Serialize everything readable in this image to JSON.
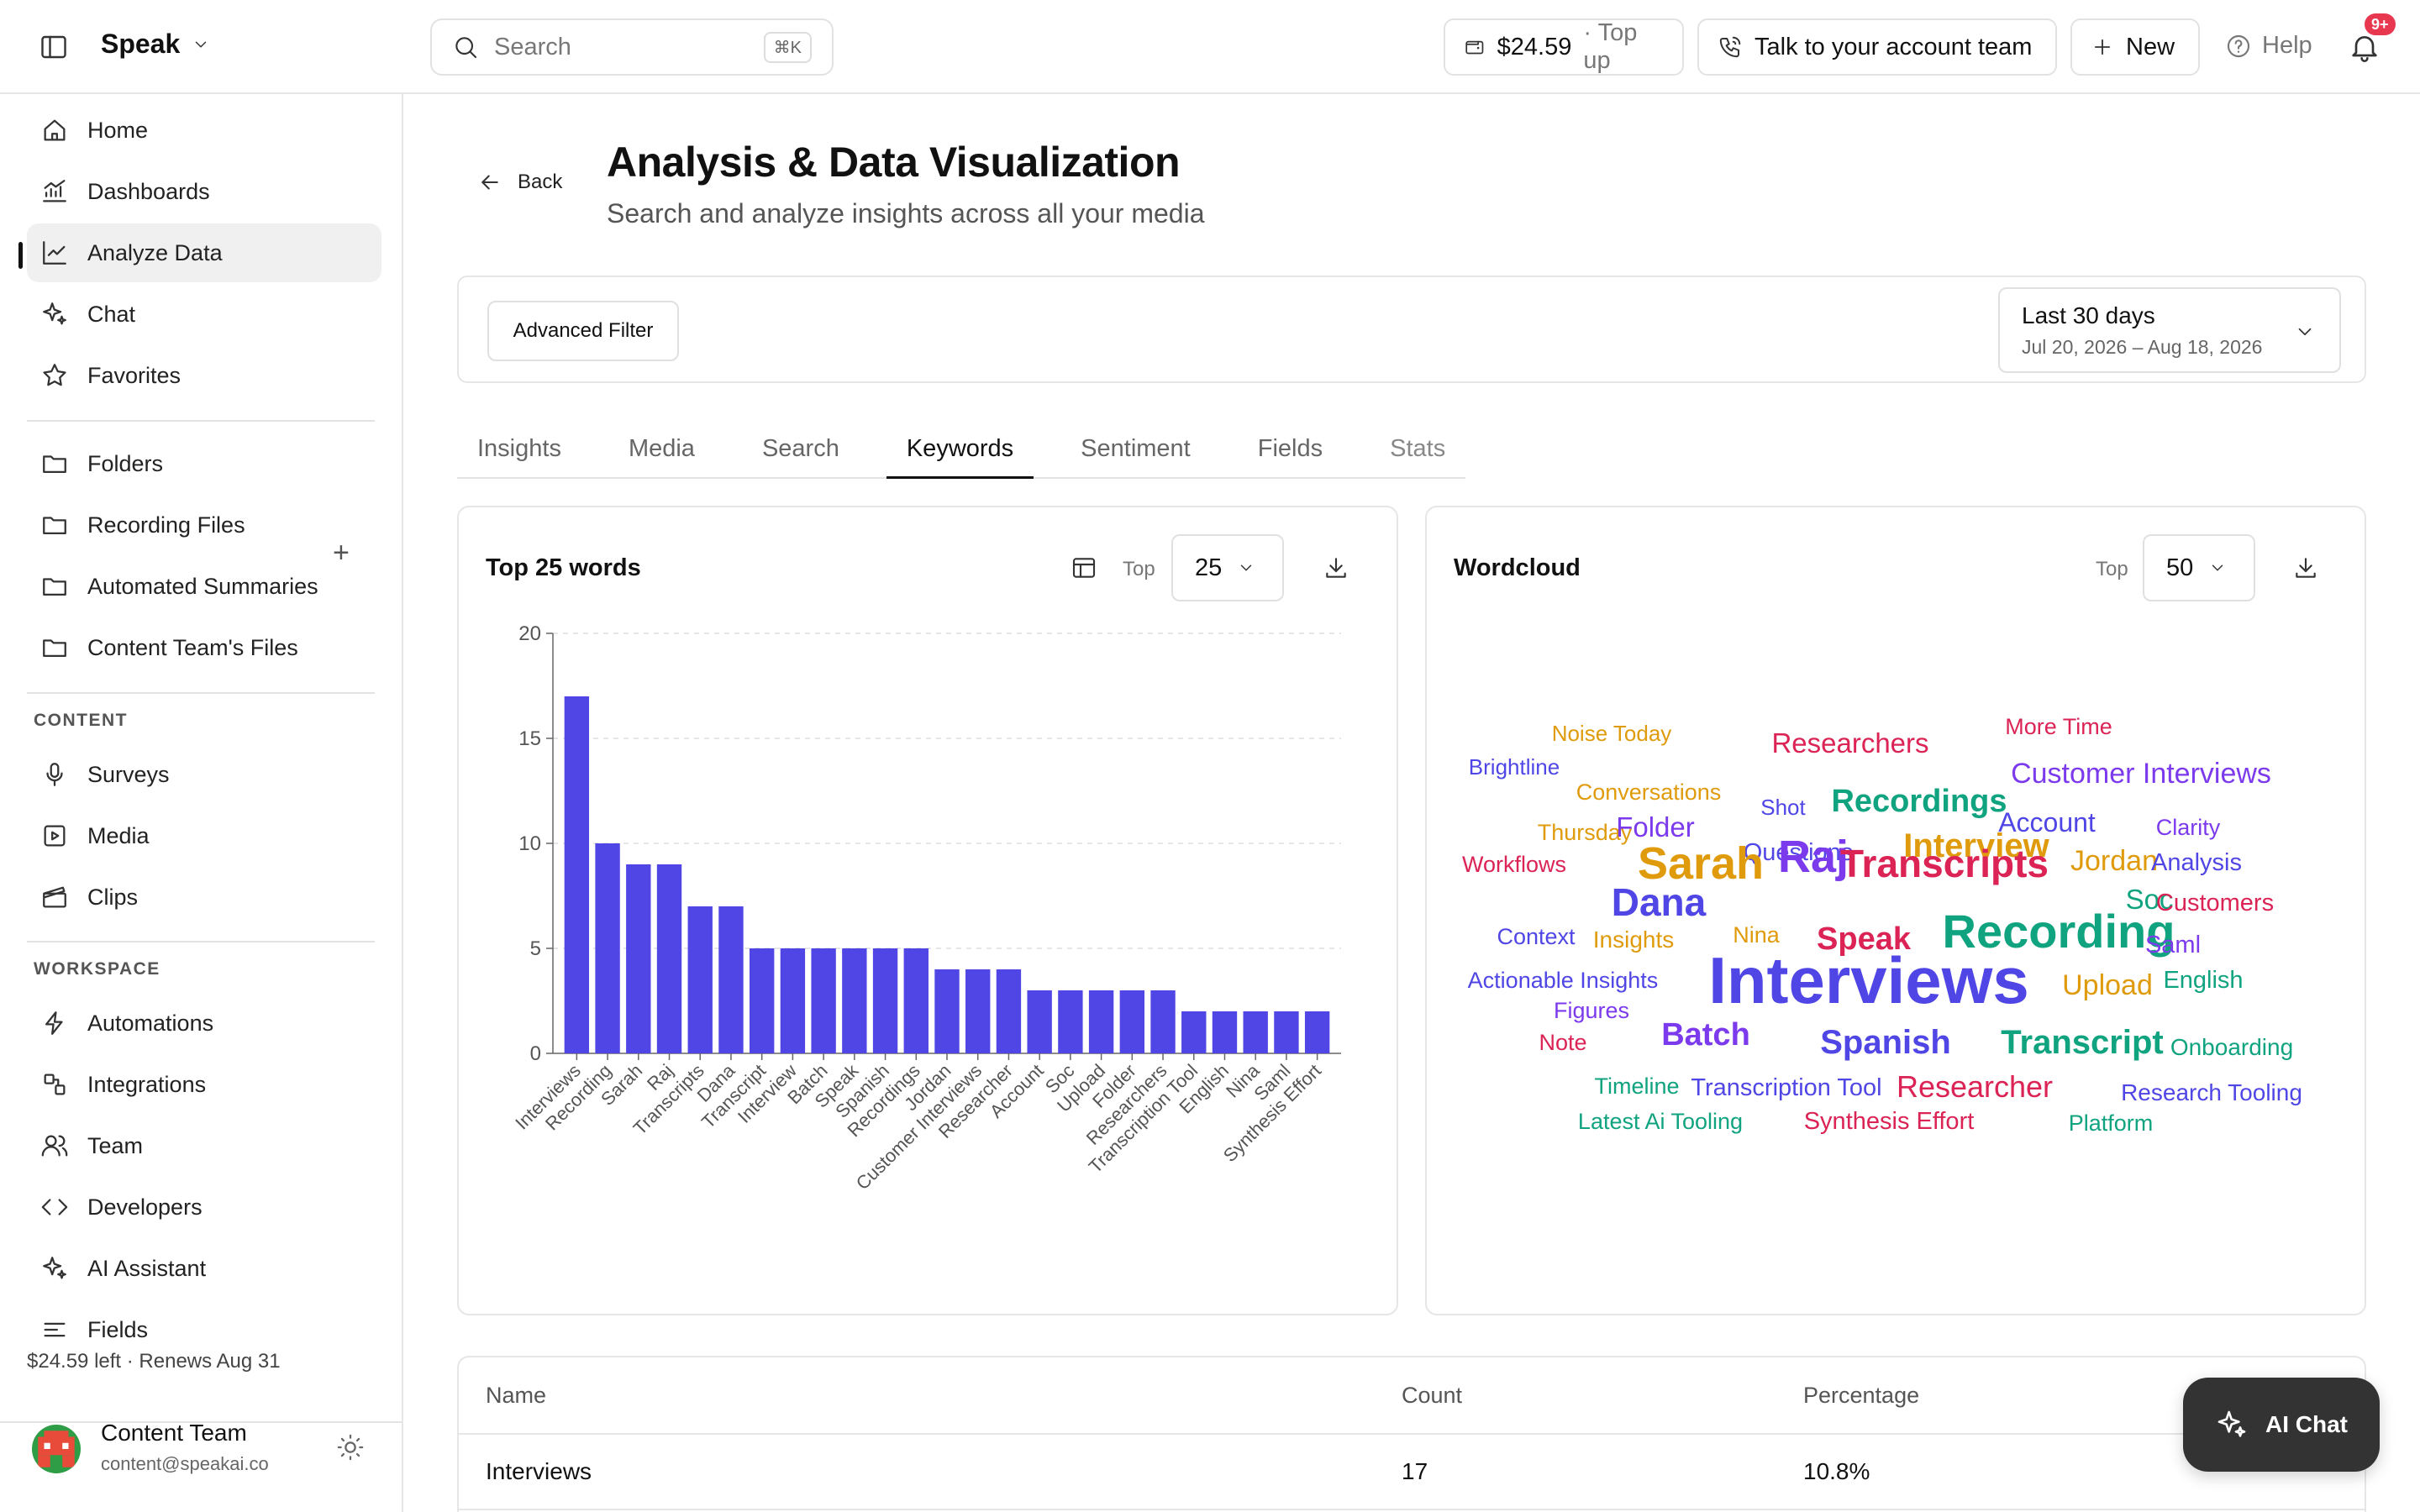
{
  "app": {
    "name": "Speak"
  },
  "search": {
    "placeholder": "Search",
    "shortcut": "⌘K"
  },
  "header": {
    "balance": "$24.59",
    "top_up": "· Top up",
    "talk": "Talk to your account team",
    "new": "New",
    "help": "Help",
    "notifications": "9+"
  },
  "sidebar": {
    "primary": [
      {
        "label": "Home",
        "icon": "home-icon"
      },
      {
        "label": "Dashboards",
        "icon": "chart-icon"
      },
      {
        "label": "Analyze Data",
        "icon": "line-chart-icon",
        "active": true
      },
      {
        "label": "Chat",
        "icon": "sparkle-icon"
      },
      {
        "label": "Favorites",
        "icon": "star-icon"
      }
    ],
    "folders": [
      {
        "label": "Folders"
      },
      {
        "label": "Recording Files"
      },
      {
        "label": "Automated Summaries"
      },
      {
        "label": "Content Team's Files"
      }
    ],
    "content_heading": "CONTENT",
    "content": [
      {
        "label": "Surveys"
      },
      {
        "label": "Media"
      },
      {
        "label": "Clips"
      }
    ],
    "workspace_heading": "WORKSPACE",
    "workspace": [
      {
        "label": "Automations"
      },
      {
        "label": "Integrations"
      },
      {
        "label": "Team"
      },
      {
        "label": "Developers"
      },
      {
        "label": "AI Assistant"
      },
      {
        "label": "Fields"
      }
    ],
    "credits": "$24.59 left · Renews Aug 31",
    "user": {
      "name": "Content Team",
      "email": "content@speakai.co"
    }
  },
  "page": {
    "back": "Back",
    "title": "Analysis & Data Visualization",
    "subtitle": "Search and analyze insights across all your media"
  },
  "filter": {
    "advanced": "Advanced Filter",
    "range_label": "Last 30 days",
    "range_dates": "Jul 20, 2026 – Aug 18, 2026"
  },
  "tabs": [
    "Insights",
    "Media",
    "Search",
    "Keywords",
    "Sentiment",
    "Fields",
    "Stats"
  ],
  "active_tab": "Keywords",
  "bar_card": {
    "title": "Top 25 words",
    "top_label": "Top",
    "top_value": "25"
  },
  "wordcloud_card": {
    "title": "Wordcloud",
    "top_label": "Top",
    "top_value": "50"
  },
  "chart_data": {
    "type": "bar",
    "title": "Top 25 words",
    "categories": [
      "Interviews",
      "Recording",
      "Sarah",
      "Raj",
      "Transcripts",
      "Dana",
      "Transcript",
      "Interview",
      "Batch",
      "Speak",
      "Spanish",
      "Recordings",
      "Jordan",
      "Customer Interviews",
      "Researcher",
      "Account",
      "Soc",
      "Upload",
      "Folder",
      "Researchers",
      "Transcription Tool",
      "English",
      "Nina",
      "Saml",
      "Synthesis Effort"
    ],
    "values": [
      17,
      10,
      9,
      9,
      7,
      7,
      5,
      5,
      5,
      5,
      5,
      5,
      4,
      4,
      4,
      3,
      3,
      3,
      3,
      3,
      2,
      2,
      2,
      2,
      2
    ],
    "ylim": [
      0,
      20
    ],
    "yticks": [
      0,
      5,
      10,
      15,
      20
    ],
    "grid": true,
    "bar_color": "#4f46e5"
  },
  "wordcloud": [
    {
      "text": "Noise Today",
      "color": "#e09b0c"
    },
    {
      "text": "Researchers",
      "color": "#db2355"
    },
    {
      "text": "More Time",
      "color": "#db2355"
    },
    {
      "text": "Brightline",
      "color": "#4f46e5"
    },
    {
      "text": "Conversations",
      "color": "#e09b0c"
    },
    {
      "text": "Customer Interviews",
      "color": "#7c3aed"
    },
    {
      "text": "Shot",
      "color": "#4f46e5"
    },
    {
      "text": "Recordings",
      "color": "#10a37f"
    },
    {
      "text": "Thursday",
      "color": "#e09b0c"
    },
    {
      "text": "Folder",
      "color": "#7c3aed"
    },
    {
      "text": "Account",
      "color": "#4f46e5"
    },
    {
      "text": "Clarity",
      "color": "#7c3aed"
    },
    {
      "text": "Questions",
      "color": "#4f46e5"
    },
    {
      "text": "Interview",
      "color": "#e09b0c"
    },
    {
      "text": "Workflows",
      "color": "#db2355"
    },
    {
      "text": "Sarah",
      "color": "#e09b0c"
    },
    {
      "text": "Raj",
      "color": "#7c3aed"
    },
    {
      "text": "Transcripts",
      "color": "#db2355"
    },
    {
      "text": "Jordan",
      "color": "#e09b0c"
    },
    {
      "text": "Analysis",
      "color": "#4f46e5"
    },
    {
      "text": "Dana",
      "color": "#4f46e5"
    },
    {
      "text": "Soc",
      "color": "#10a37f"
    },
    {
      "text": "Customers",
      "color": "#db2355"
    },
    {
      "text": "Context",
      "color": "#4f46e5"
    },
    {
      "text": "Insights",
      "color": "#e09b0c"
    },
    {
      "text": "Nina",
      "color": "#e09b0c"
    },
    {
      "text": "Speak",
      "color": "#db2355"
    },
    {
      "text": "Recording",
      "color": "#10a37f"
    },
    {
      "text": "Saml",
      "color": "#7c3aed"
    },
    {
      "text": "Actionable Insights",
      "color": "#4f46e5"
    },
    {
      "text": "Interviews",
      "color": "#4f46e5"
    },
    {
      "text": "Upload",
      "color": "#e09b0c"
    },
    {
      "text": "English",
      "color": "#10a37f"
    },
    {
      "text": "Figures",
      "color": "#7c3aed"
    },
    {
      "text": "Note",
      "color": "#db2355"
    },
    {
      "text": "Batch",
      "color": "#7c3aed"
    },
    {
      "text": "Spanish",
      "color": "#4f46e5"
    },
    {
      "text": "Transcript",
      "color": "#10a37f"
    },
    {
      "text": "Onboarding",
      "color": "#10a37f"
    },
    {
      "text": "Timeline",
      "color": "#10a37f"
    },
    {
      "text": "Transcription Tool",
      "color": "#4f46e5"
    },
    {
      "text": "Researcher",
      "color": "#db2355"
    },
    {
      "text": "Research Tooling",
      "color": "#4f46e5"
    },
    {
      "text": "Latest Ai Tooling",
      "color": "#10a37f"
    },
    {
      "text": "Synthesis Effort",
      "color": "#db2355"
    },
    {
      "text": "Platform",
      "color": "#10a37f"
    }
  ],
  "table": {
    "headers": [
      "Name",
      "Count",
      "Percentage"
    ],
    "rows": [
      [
        "Interviews",
        "17",
        "10.8%"
      ]
    ]
  },
  "ai_chat": "AI Chat"
}
